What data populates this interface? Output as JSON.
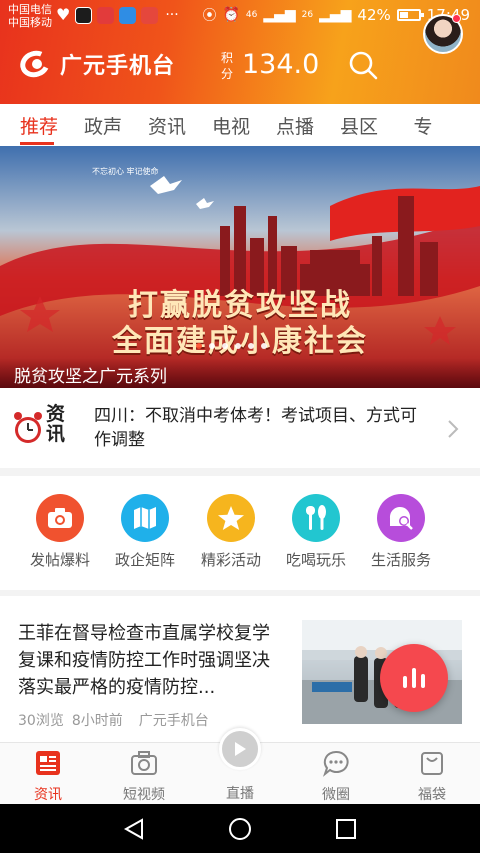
{
  "status_bar": {
    "carrier_1": "中国电信",
    "carrier_2": "中国移动",
    "dots": "···",
    "network": "46",
    "network2": "26",
    "battery": "42%",
    "time": "17:49"
  },
  "header": {
    "app_name": "广元手机台",
    "points_label": "积分",
    "points_value": "134.0"
  },
  "tabs": [
    {
      "label": "推荐",
      "active": true
    },
    {
      "label": "政声"
    },
    {
      "label": "资讯"
    },
    {
      "label": "电视"
    },
    {
      "label": "点播"
    },
    {
      "label": "县区"
    },
    {
      "label": "专"
    }
  ],
  "banner": {
    "slogan_line1": "打赢脱贫攻坚战",
    "slogan_line2": "全面建成小康社会",
    "caption": "脱贫攻坚之广元系列",
    "small_text_1": "不忘初心 牢记使命"
  },
  "ticker": {
    "label": "资讯",
    "title": "四川：不取消中考体考！考试项目、方式可作调整"
  },
  "shortcuts": [
    {
      "label": "发帖爆料",
      "icon": "camera-icon",
      "color": "#f0522f"
    },
    {
      "label": "政企矩阵",
      "icon": "map-icon",
      "color": "#1fb0ea"
    },
    {
      "label": "精彩活动",
      "icon": "star-icon",
      "color": "#f6b51e"
    },
    {
      "label": "吃喝玩乐",
      "icon": "cutlery-icon",
      "color": "#22c6d0"
    },
    {
      "label": "生活服务",
      "icon": "service-search-icon",
      "color": "#b74ddb"
    }
  ],
  "article": {
    "title": "王菲在督导检查市直属学校复学复课和疫情防控工作时强调坚决落实最严格的疫情防控...",
    "views": "30浏览",
    "time": "8小时前",
    "source": "广元手机台"
  },
  "bottom_nav": {
    "items": [
      {
        "label": "资讯",
        "active": true
      },
      {
        "label": "短视频"
      },
      {
        "label": "直播"
      },
      {
        "label": "微圈"
      },
      {
        "label": "福袋"
      }
    ]
  },
  "colors": {
    "accent": "#e8321d",
    "header_gradient_end": "#f7a21b"
  }
}
